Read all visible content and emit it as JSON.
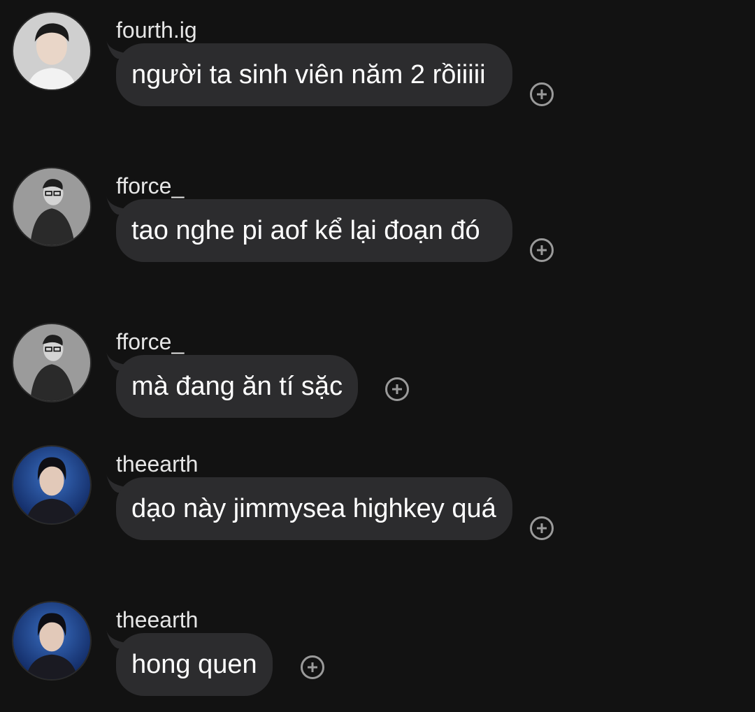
{
  "messages": [
    {
      "username": "fourth.ig",
      "text": "người ta sinh viên năm 2 rồiiiii",
      "avatar": "light-portrait-avatar"
    },
    {
      "username": "fforce_",
      "text": "tao nghe pi aof kể lại đoạn đó",
      "avatar": "monochrome-portrait-avatar"
    },
    {
      "username": "fforce_",
      "text": "mà đang ăn tí sặc",
      "avatar": "monochrome-portrait-avatar"
    },
    {
      "username": "theearth",
      "text": "dạo này jimmysea highkey quá",
      "avatar": "blue-portrait-avatar"
    },
    {
      "username": "theearth",
      "text": "hong quen",
      "avatar": "blue-portrait-avatar"
    }
  ],
  "colors": {
    "background": "#121212",
    "bubble": "#2c2c2e",
    "text": "#ffffff",
    "react_icon": "#9a9a9a"
  },
  "icons": {
    "react": "add-reaction-icon"
  }
}
